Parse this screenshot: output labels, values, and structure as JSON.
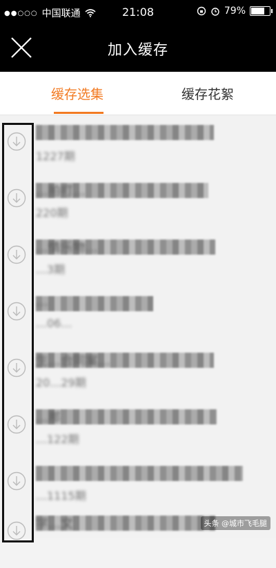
{
  "status_bar": {
    "carrier": "中国联通",
    "time": "21:08",
    "battery_percent": "79%",
    "battery_level": 0.79
  },
  "header": {
    "title": "加入缓存"
  },
  "tabs": [
    {
      "label": "缓存选集",
      "active": true
    },
    {
      "label": "缓存花絮",
      "active": false
    }
  ],
  "episodes": [
    {
      "title": "",
      "episode": "1227期"
    },
    {
      "title": "…拍打…",
      "episode": "220期"
    },
    {
      "title": "…情乐物…",
      "episode": "…3期"
    },
    {
      "title": "…",
      "episode": "…06…"
    },
    {
      "title": "生…合同案…",
      "episode": "20…29期"
    },
    {
      "title": "…那",
      "episode": "…122期"
    },
    {
      "title": "",
      "episode": "…1115期"
    },
    {
      "title": "字…文",
      "episode": ""
    }
  ],
  "watermark": "头条 @城市飞毛腿"
}
